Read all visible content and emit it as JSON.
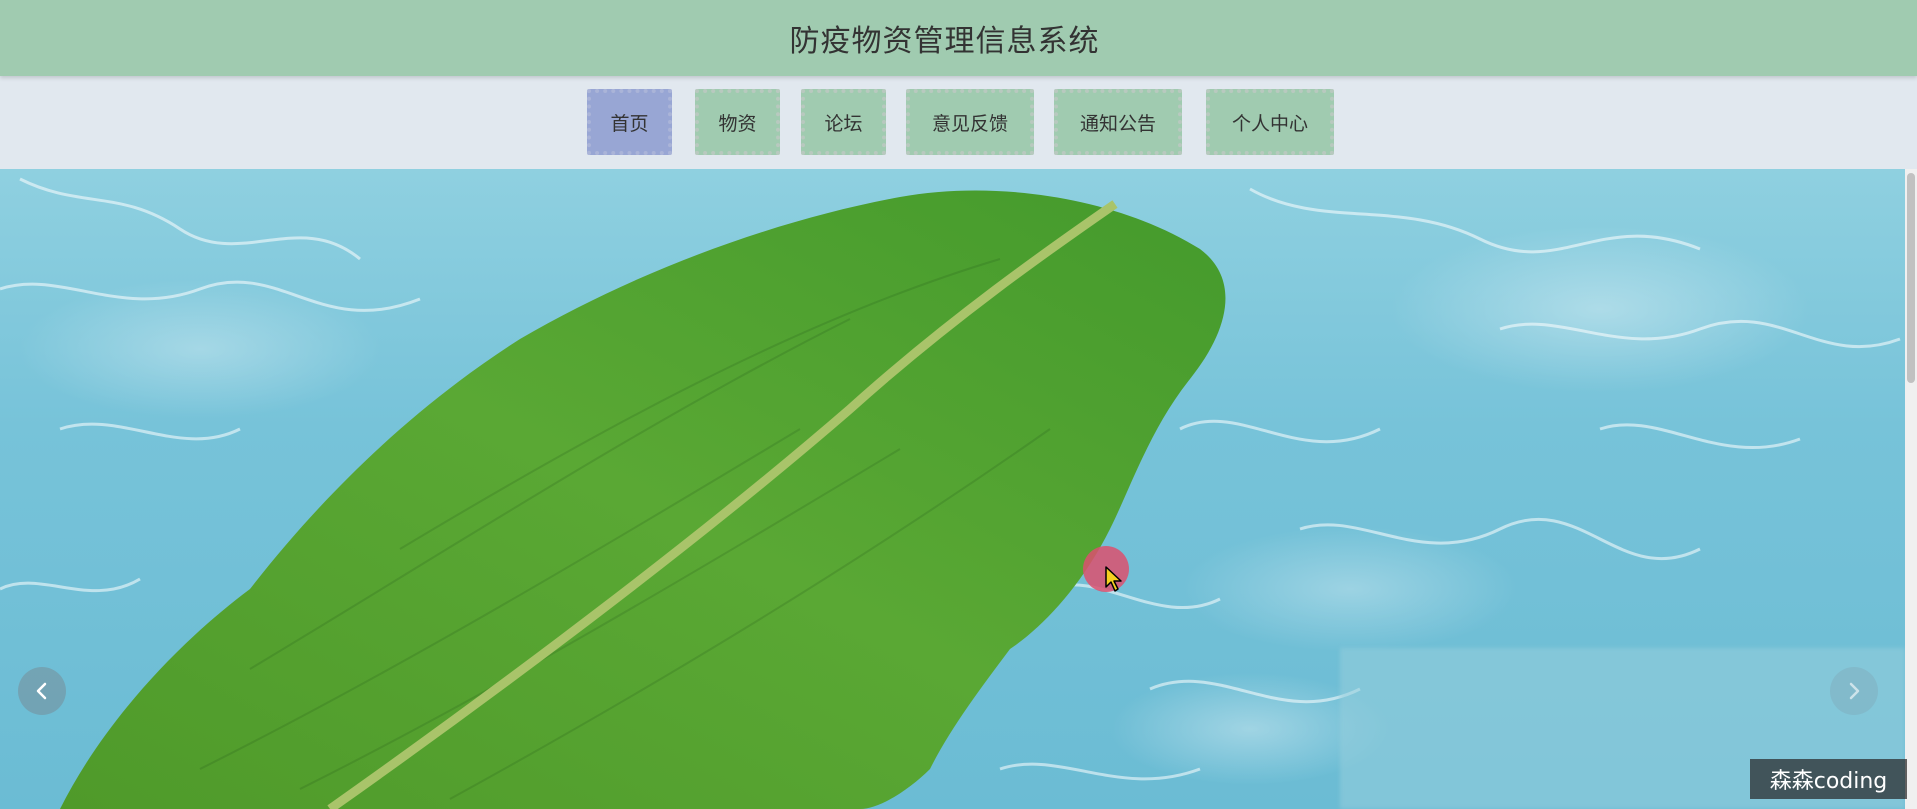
{
  "header": {
    "title": "防疫物资管理信息系统"
  },
  "nav": {
    "items": [
      {
        "label": "首页",
        "active": true
      },
      {
        "label": "物资",
        "active": false
      },
      {
        "label": "论坛",
        "active": false
      },
      {
        "label": "意见反馈",
        "active": false
      },
      {
        "label": "通知公告",
        "active": false
      },
      {
        "label": "个人中心",
        "active": false
      }
    ]
  },
  "carousel": {
    "prev_icon": "chevron-left-icon",
    "next_icon": "chevron-right-icon"
  },
  "watermark": {
    "text": "森森coding"
  },
  "colors": {
    "header_bg": "#a0cbb0",
    "nav_bg": "#e1e8ef",
    "nav_item_bg": "#a0cbb0",
    "nav_item_active_bg": "#98a6d4",
    "cursor_highlight": "#dc506e"
  }
}
